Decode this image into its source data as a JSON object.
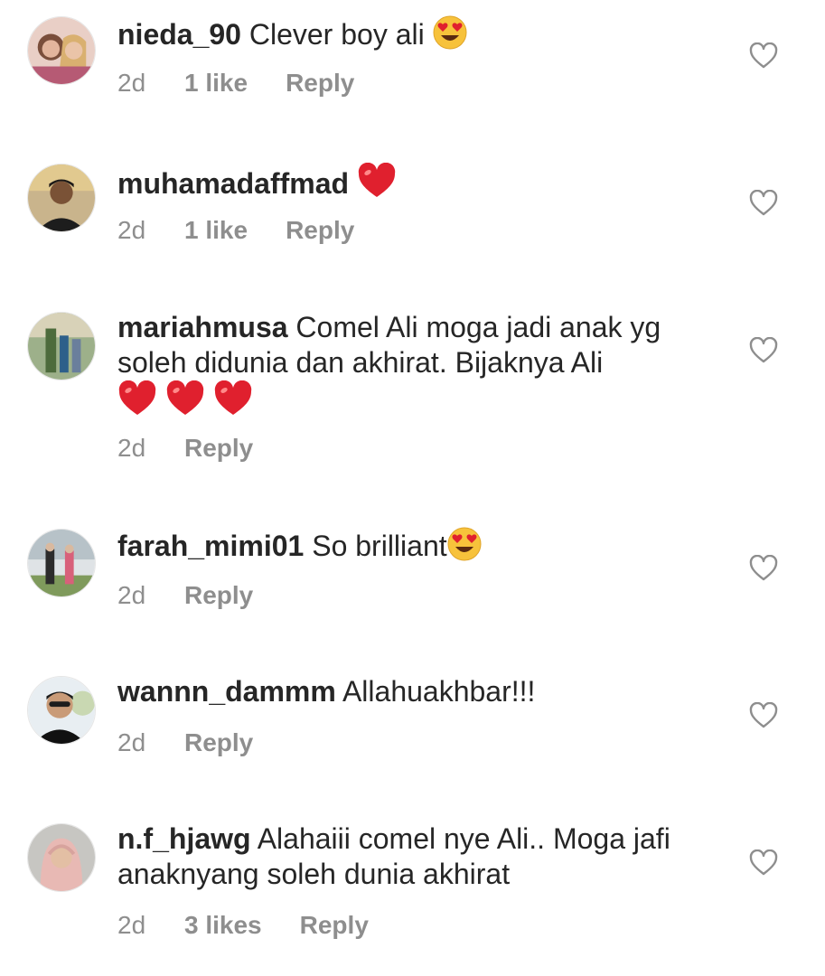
{
  "comments": [
    {
      "username": "nieda_90",
      "text": "Clever boy ali",
      "emojis": [
        "heart-eyes"
      ],
      "time": "2d",
      "likes": "1 like",
      "reply": "Reply",
      "avatar": "woman-hijab-photo-avatar"
    },
    {
      "username": "muhamadaffmad",
      "text": "",
      "emojis": [
        "red-heart"
      ],
      "time": "2d",
      "likes": "1 like",
      "reply": "Reply",
      "avatar": "man-photo-avatar"
    },
    {
      "username": "mariahmusa",
      "text": "Comel Ali moga jadi anak yg soleh didunia dan akhirat. Bijaknya Ali",
      "emojis": [
        "red-heart",
        "red-heart",
        "red-heart"
      ],
      "time": "2d",
      "likes": "",
      "reply": "Reply",
      "avatar": "family-photo-avatar"
    },
    {
      "username": "farah_mimi01",
      "text": "So brilliant",
      "emojis": [
        "heart-eyes"
      ],
      "time": "2d",
      "likes": "",
      "reply": "Reply",
      "avatar": "two-women-photo-avatar"
    },
    {
      "username": "wannn_dammm",
      "text": "Allahuakhbar!!!",
      "emojis": [],
      "time": "2d",
      "likes": "",
      "reply": "Reply",
      "avatar": "man-sunglasses-photo-avatar"
    },
    {
      "username": "n.f_hjawg",
      "text": "Alahaiii comel nye Ali.. Moga jafi anaknyang soleh dunia akhirat",
      "emojis": [],
      "time": "2d",
      "likes": "3 likes",
      "reply": "Reply",
      "avatar": "woman-pink-hijab-photo-avatar"
    }
  ],
  "colors": {
    "text": "#262626",
    "meta": "#8e8e8e",
    "heart_red": "#e0202e",
    "emoji_yellow": "#f7c23b"
  }
}
